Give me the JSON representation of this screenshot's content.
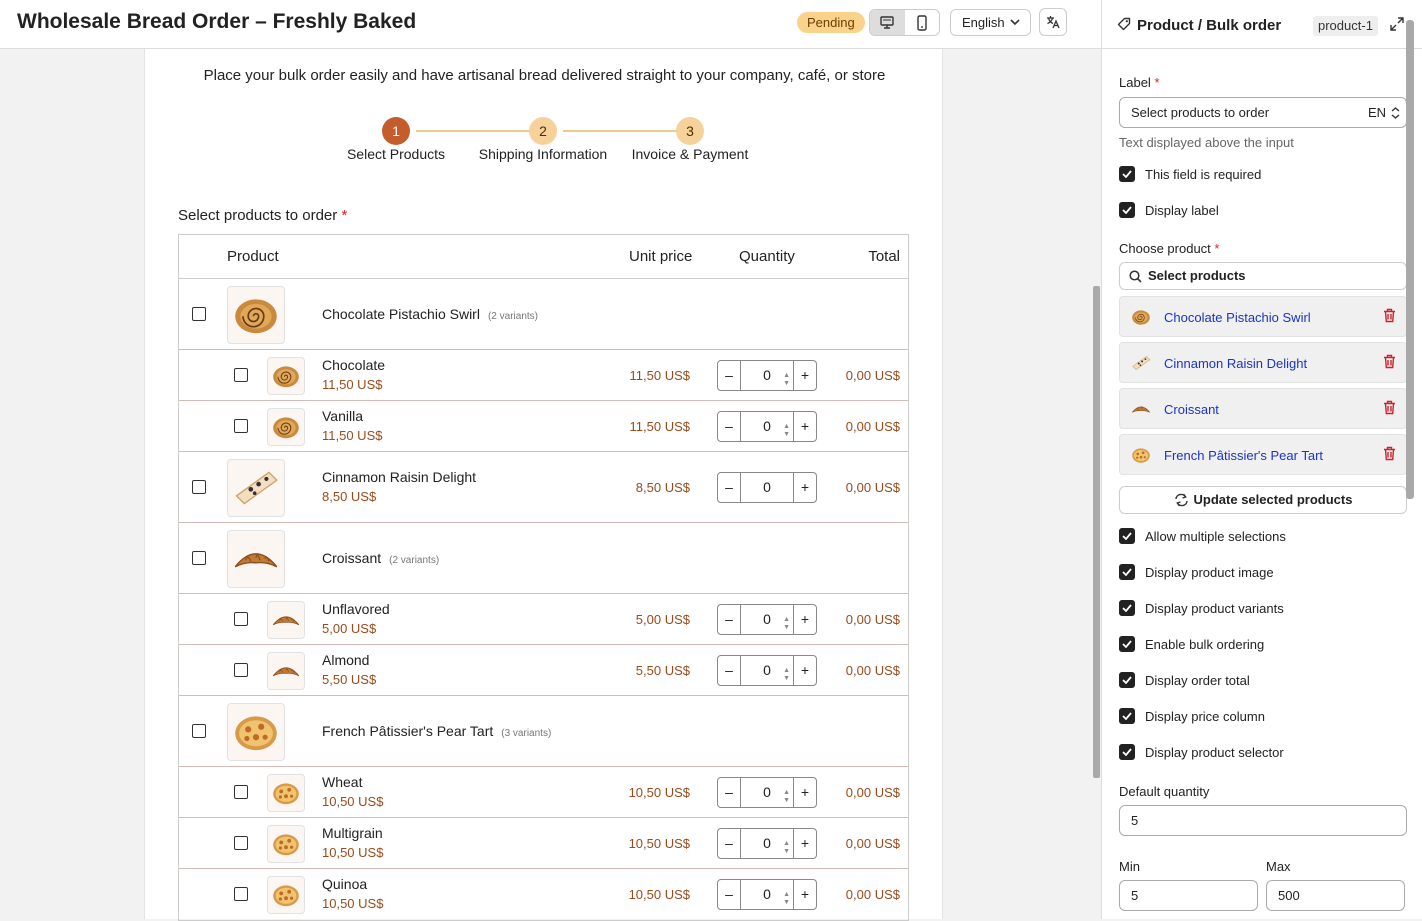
{
  "header": {
    "title": "Wholesale Bread Order – Freshly Baked",
    "status": "Pending",
    "language": "English"
  },
  "form": {
    "intro": "Place your bulk order easily and have artisanal bread delivered straight to your company, café, or store",
    "steps": [
      {
        "number": "1",
        "label": "Select Products"
      },
      {
        "number": "2",
        "label": "Shipping Information"
      },
      {
        "number": "3",
        "label": "Invoice & Payment"
      }
    ],
    "field_label": "Select products to order",
    "required_mark": "*",
    "table_headers": {
      "product": "Product",
      "unit_price": "Unit price",
      "quantity": "Quantity",
      "total": "Total"
    },
    "rows": [
      {
        "type": "parent",
        "name": "Chocolate Pistachio Swirl",
        "variants": "(2 variants)",
        "img": "swirl"
      },
      {
        "type": "child",
        "name": "Chocolate",
        "price": "11,50 US$",
        "unit_price": "11,50 US$",
        "qty": "0",
        "total": "0,00 US$",
        "img": "swirl"
      },
      {
        "type": "child",
        "name": "Vanilla",
        "price": "11,50 US$",
        "unit_price": "11,50 US$",
        "qty": "0",
        "total": "0,00 US$",
        "img": "swirl"
      },
      {
        "type": "single",
        "name": "Cinnamon Raisin Delight",
        "price": "8,50 US$",
        "unit_price": "8,50 US$",
        "qty": "0",
        "total": "0,00 US$",
        "img": "raisin"
      },
      {
        "type": "parent",
        "name": "Croissant",
        "variants": "(2 variants)",
        "img": "croissant"
      },
      {
        "type": "child",
        "name": "Unflavored",
        "price": "5,00 US$",
        "unit_price": "5,00 US$",
        "qty": "0",
        "total": "0,00 US$",
        "img": "croissant"
      },
      {
        "type": "child",
        "name": "Almond",
        "price": "5,50 US$",
        "unit_price": "5,50 US$",
        "qty": "0",
        "total": "0,00 US$",
        "img": "croissant"
      },
      {
        "type": "parent",
        "name": "French Pâtissier's Pear Tart",
        "variants": "(3 variants)",
        "img": "tart"
      },
      {
        "type": "child",
        "name": "Wheat",
        "price": "10,50 US$",
        "unit_price": "10,50 US$",
        "qty": "0",
        "total": "0,00 US$",
        "img": "tart"
      },
      {
        "type": "child",
        "name": "Multigrain",
        "price": "10,50 US$",
        "unit_price": "10,50 US$",
        "qty": "0",
        "total": "0,00 US$",
        "img": "tart"
      },
      {
        "type": "child",
        "name": "Quinoa",
        "price": "10,50 US$",
        "unit_price": "10,50 US$",
        "qty": "0",
        "total": "0,00 US$",
        "img": "tart"
      }
    ]
  },
  "panel": {
    "title": "Product / Bulk order",
    "id": "product-1",
    "label_title": "Label",
    "label_value": "Select products to order",
    "label_lang": "EN",
    "label_hint": "Text displayed above the input",
    "checks_top": [
      "This field is required",
      "Display label"
    ],
    "choose_title": "Choose product",
    "search_placeholder": "Select products",
    "selected": [
      {
        "name": "Chocolate Pistachio Swirl",
        "img": "swirl"
      },
      {
        "name": "Cinnamon Raisin Delight",
        "img": "raisin"
      },
      {
        "name": "Croissant",
        "img": "croissant"
      },
      {
        "name": "French Pâtissier's Pear Tart",
        "img": "tart"
      }
    ],
    "update_label": "Update selected products",
    "checks": [
      "Allow multiple selections",
      "Display product image",
      "Display product variants",
      "Enable bulk ordering",
      "Display order total",
      "Display price column",
      "Display product selector"
    ],
    "default_qty_label": "Default quantity",
    "default_qty": "5",
    "min_label": "Min",
    "min_value": "5",
    "max_label": "Max",
    "max_value": "500"
  },
  "colors": {
    "accent": "#c55c2c",
    "step_todo": "#f6d19a",
    "price": "#9a4a1c",
    "link": "#1a33c9",
    "delete": "#d0202a",
    "badge": "#fbd28b"
  }
}
